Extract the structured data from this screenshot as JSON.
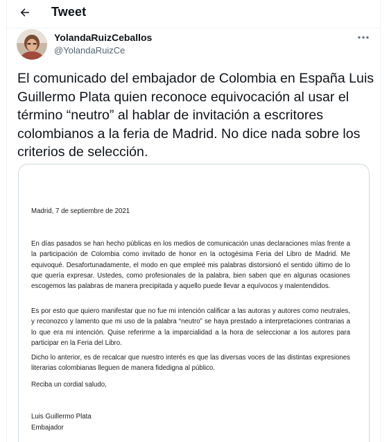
{
  "header": {
    "title": "Tweet",
    "back_icon": "arrow-left-icon"
  },
  "author": {
    "display_name": "YolandaRuizCeballos",
    "handle": "@YolandaRuizCe",
    "avatar_icon": "user-avatar-photo"
  },
  "tweet": {
    "text": "El comunicado del embajador de Colombia en España Luis Guillermo Plata quien reconoce equivocación al usar el término “neutro” al hablar de invitación a escritores colombianos a la feria de Madrid. No dice nada sobre los criterios de selección.",
    "more_icon": "more-horizontal-icon"
  },
  "letter": {
    "date": "Madrid, 7 de septiembre de 2021",
    "paragraphs": [
      "En días pasados se han hecho públicas en los medios de comunicación unas declaraciones mías frente a la participación de Colombia como invitado de honor en la octogésima Feria del Libro de Madrid. Me equivoqué. Desafortunadamente, el modo en que empleé mis palabras distorsionó el sentido último de lo que quería expresar. Ustedes, como profesionales de la palabra, bien saben que en algunas ocasiones escogemos las palabras de manera precipitada y aquello puede llevar a equívocos y malentendidos.",
      "Es por esto que quiero manifestar que no fue mi intención calificar a las autoras y autores como neutrales, y reconozco y lamento que mi uso de la palabra “neutro” se haya prestado a interpretaciones contrarias a lo que era mi intención. Quise referirme a la imparcialidad a la hora de seleccionar a los autores para participar en la Feria del Libro.",
      "Dicho lo anterior, es de recalcar que nuestro interés es que las diversas voces de las distintas expresiones literarias colombianas lleguen de manera fidedigna al público.",
      "Reciba un cordial saludo,"
    ],
    "signature_name": "Luis Guillermo Plata",
    "signature_title": "Embajador"
  },
  "colors": {
    "text_primary": "#0f1419",
    "text_secondary": "#536471",
    "border": "#cfd9de"
  }
}
